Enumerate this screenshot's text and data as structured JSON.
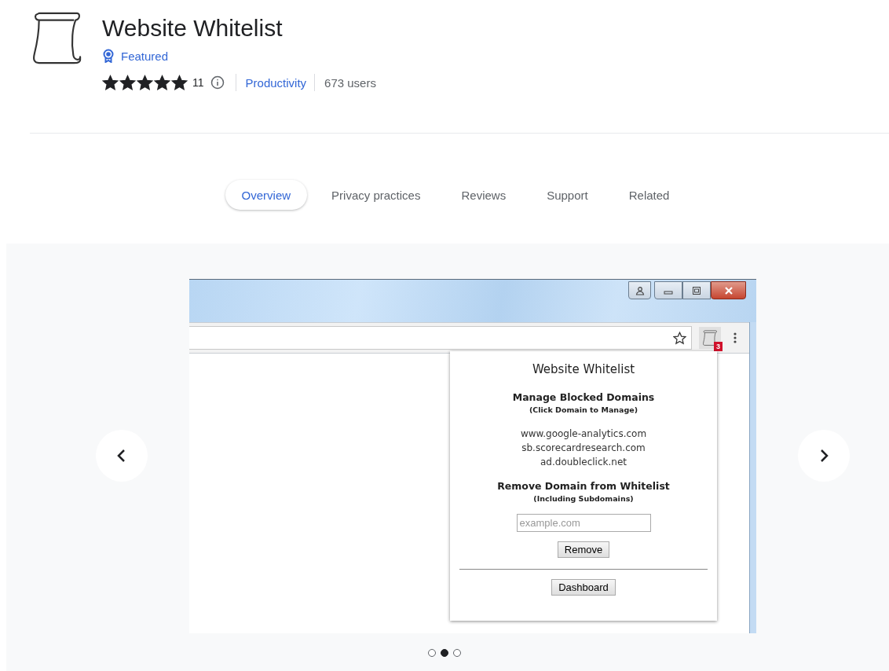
{
  "app": {
    "title": "Website Whitelist",
    "featured": "Featured",
    "stars": 5,
    "rating_count": "11",
    "category": "Productivity",
    "users": "673 users"
  },
  "tabs": [
    {
      "label": "Overview",
      "selected": true
    },
    {
      "label": "Privacy practices",
      "selected": false
    },
    {
      "label": "Reviews",
      "selected": false
    },
    {
      "label": "Support",
      "selected": false
    },
    {
      "label": "Related",
      "selected": false
    }
  ],
  "screenshot": {
    "badge": "3",
    "popup": {
      "title": "Website Whitelist",
      "manage_heading": "Manage Blocked Domains",
      "manage_sub": "(Click Domain to Manage)",
      "domains": [
        "www.google-analytics.com",
        "sb.scorecardresearch.com",
        "ad.doubleclick.net"
      ],
      "remove_heading": "Remove Domain from Whitelist",
      "remove_sub": "(Including Subdomains)",
      "placeholder": "example.com",
      "remove_button": "Remove",
      "dashboard_button": "Dashboard"
    }
  },
  "carousel": {
    "slides": [
      {
        "selected": false
      },
      {
        "selected": true
      },
      {
        "selected": false
      }
    ]
  }
}
